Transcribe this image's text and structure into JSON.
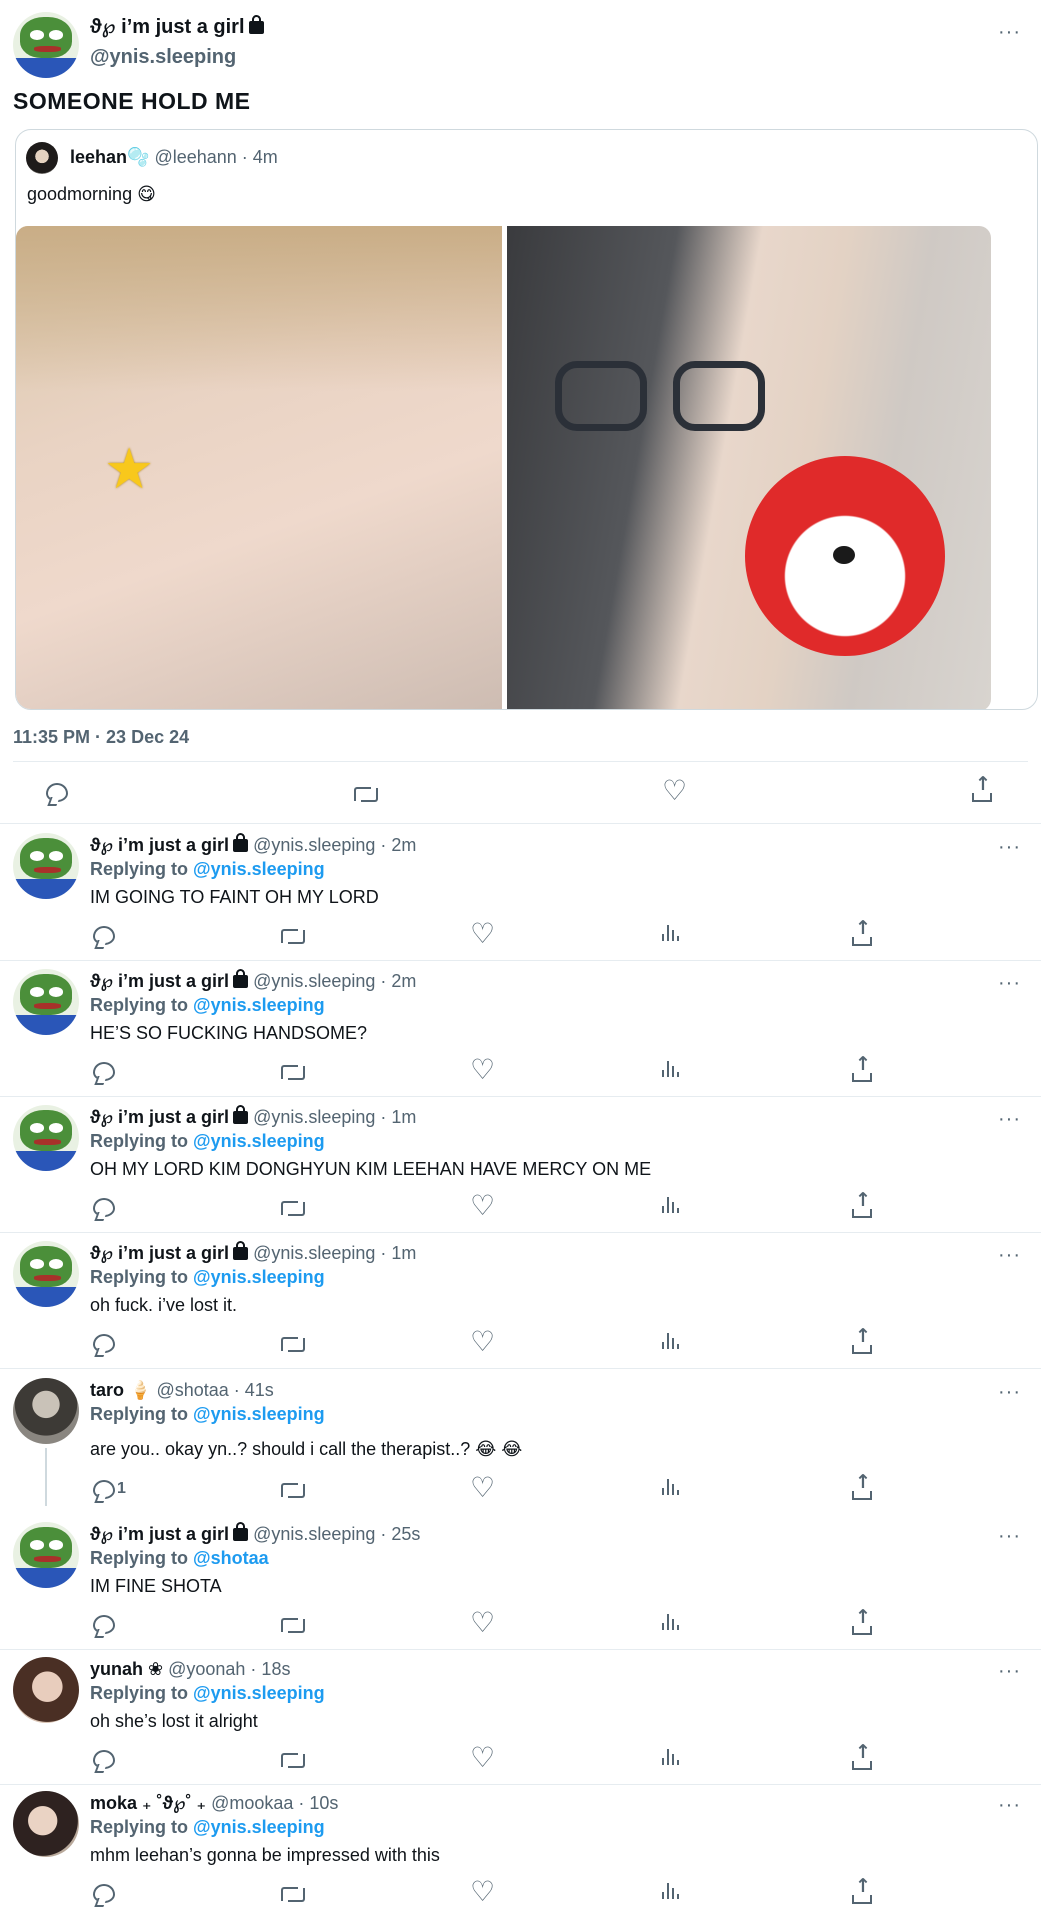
{
  "main_tweet": {
    "display_name": "ϑ℘ i’m just a girl",
    "handle": "@ynis.sleeping",
    "text": "SOMEONE HOLD ME",
    "timestamp": "11:35 PM · 23 Dec 24",
    "more": "···",
    "quote": {
      "display_name": "leehan",
      "name_emoji": "🫧",
      "handle": "@leehann · 4m",
      "text": "goodmorning 😋"
    }
  },
  "replies": [
    {
      "display_name": "ϑ℘ i’m just a girl",
      "handle": "@ynis.sleeping · 2m",
      "replying_label": "Replying to",
      "replying_to": "@ynis.sleeping",
      "text": "IM GOING TO FAINT OH MY LORD",
      "reply_count": ""
    },
    {
      "display_name": "ϑ℘ i’m just a girl",
      "handle": "@ynis.sleeping · 2m",
      "replying_label": "Replying to",
      "replying_to": "@ynis.sleeping",
      "text": "HE’S SO FUCKING HANDSOME?",
      "reply_count": ""
    },
    {
      "display_name": "ϑ℘ i’m just a girl",
      "handle": "@ynis.sleeping · 1m",
      "replying_label": "Replying to",
      "replying_to": "@ynis.sleeping",
      "text": "OH MY LORD KIM DONGHYUN KIM LEEHAN HAVE MERCY ON ME",
      "reply_count": ""
    },
    {
      "display_name": "ϑ℘ i’m just a girl",
      "handle": "@ynis.sleeping · 1m",
      "replying_label": "Replying to",
      "replying_to": "@ynis.sleeping",
      "text": "oh fuck. i’ve lost it.",
      "reply_count": ""
    },
    {
      "display_name": "taro 🍦",
      "handle": "@shotaa · 41s",
      "replying_label": "Replying to",
      "replying_to": "@ynis.sleeping",
      "text": "are you.. okay yn..? should i call the therapist..? 😂 😂",
      "reply_count": "1"
    },
    {
      "display_name": "ϑ℘ i’m just a girl",
      "handle": "@ynis.sleeping · 25s",
      "replying_label": "Replying to",
      "replying_to": "@shotaa",
      "text": "IM FINE SHOTA",
      "reply_count": ""
    },
    {
      "display_name": "yunah ❀",
      "handle": "@yoonah · 18s",
      "replying_label": "Replying to",
      "replying_to": "@ynis.sleeping",
      "text": "oh she’s lost it alright",
      "reply_count": ""
    },
    {
      "display_name": "moka ₊ ˚ϑ℘˚ ₊",
      "handle": "@mookaa · 10s",
      "replying_label": "Replying to",
      "replying_to": "@ynis.sleeping",
      "text": "mhm leehan’s gonna be impressed with this",
      "reply_count": ""
    }
  ],
  "icons": [
    "reply-icon",
    "retweet-icon",
    "like-icon",
    "views-icon",
    "share-icon",
    "lock-icon",
    "more-icon",
    "star-sticker"
  ],
  "colors": {
    "link_blue": "#1d9bf0",
    "secondary_text": "#536471",
    "border": "#cfd9de"
  }
}
